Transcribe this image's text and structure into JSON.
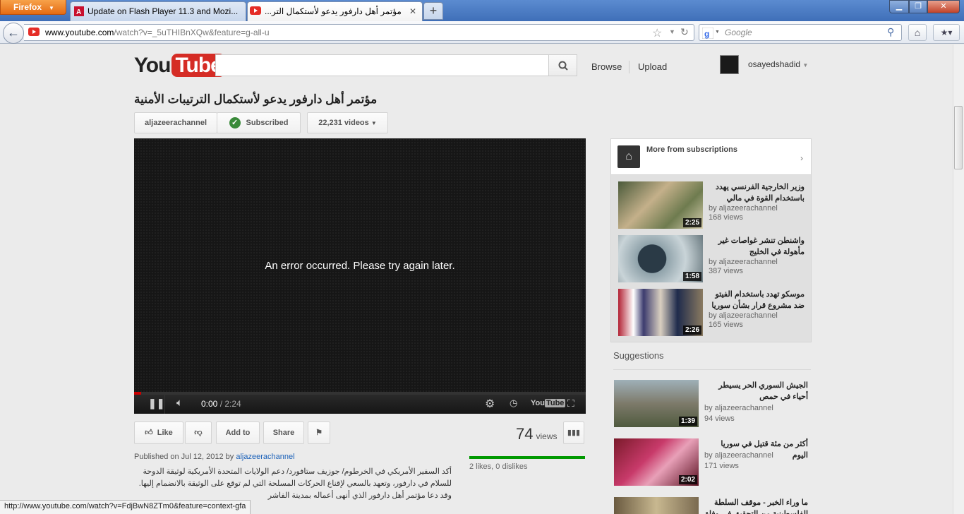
{
  "browser": {
    "app_button": "Firefox",
    "tabs": [
      {
        "title": "Update on Flash Player 11.3 and Mozi...",
        "active": false
      },
      {
        "title": "مؤتمر أهل دارفور يدعو لأستكمال التر...",
        "active": true
      }
    ],
    "url_host": "www.youtube.com",
    "url_path": "/watch?v=_5uTHIBnXQw&feature=g-all-u",
    "search_engine": "Google",
    "status_url": "http://www.youtube.com/watch?v=FdjBwN8ZTm0&feature=context-gfa"
  },
  "header": {
    "logo_you": "You",
    "logo_tube": "Tube",
    "browse": "Browse",
    "upload": "Upload",
    "username": "osayedshadid"
  },
  "video": {
    "title": "مؤتمر أهل دارفور يدعو لأستكمال الترتيبات الأمنية",
    "channel": "aljazeerachannel",
    "subscribed": "Subscribed",
    "videos_count": "22,231 videos",
    "error": "An error occurred. Please try again later.",
    "time_current": "0:00",
    "time_total": "/ 2:24",
    "like": "Like",
    "add_to": "Add to",
    "share": "Share",
    "views": "74",
    "views_label": "views",
    "likes_text": "2 likes, 0 dislikes",
    "like_ratio": 1.0,
    "published_prefix": "Published on Jul 12, 2012 by",
    "published_by": "aljazeerachannel",
    "description": "أكد السفير الأمريكي في الخرطوم/ جوزيف ستافورد/ دعم الولايات المتحدة الأمريكية لوثيقة الدوحة للسلام في دارفور، وتعهد بالسعي لإقناع الحركات المسلحة التي لم توقع على الوثيقة بالانضمام إليها. وقد دعا مؤتمر أهل دارفور الذي أنهى أعماله بمدينة الفاشر"
  },
  "sidebar": {
    "subs_title": "More from subscriptions",
    "subs": [
      {
        "title": "وزير الخارجية الفرنسي يهدد باستخدام القوة في مالي",
        "by": "by aljazeerachannel",
        "views": "168 views",
        "duration": "2:25"
      },
      {
        "title": "واشنطن تنشر غواصات غير مأهولة في الخليج",
        "by": "by aljazeerachannel",
        "views": "387 views",
        "duration": "1:58"
      },
      {
        "title": "موسكو تهدد باستخدام الفيتو ضد مشروع قرار بشأن سوريا",
        "by": "by aljazeerachannel",
        "views": "165 views",
        "duration": "2:26"
      }
    ],
    "suggestions_title": "Suggestions",
    "suggestions": [
      {
        "title": "الجيش السوري الحر يسيطر أحياء في حمص",
        "by": "by aljazeerachannel",
        "views": "94 views",
        "duration": "1:39"
      },
      {
        "title": "أكثر من مئة قتيل في سوريا اليوم",
        "by": "by aljazeerachannel",
        "views": "171 views",
        "duration": "2:02"
      },
      {
        "title": "ما وراء الخبر - موقف السلطة الفلسطينية من التحقيق في وفاة",
        "by": "",
        "views": "",
        "duration": ""
      }
    ]
  }
}
